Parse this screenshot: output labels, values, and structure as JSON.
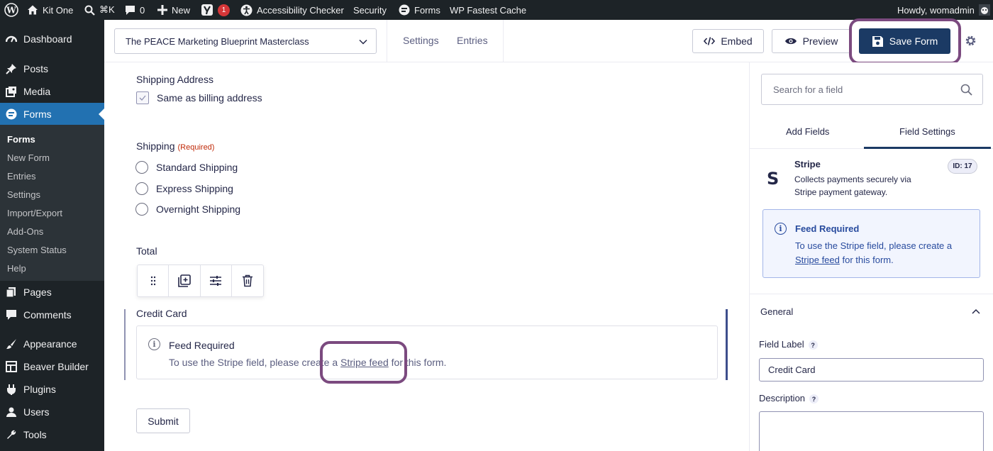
{
  "admin_bar": {
    "site_name": "Kit One",
    "shortcut": "⌘K",
    "comments_count": "0",
    "new_label": "New",
    "yoast_badge": "1",
    "accessibility": "Accessibility Checker",
    "security": "Security",
    "forms": "Forms",
    "cache": "WP Fastest Cache",
    "greeting": "Howdy, womadmin"
  },
  "sidebar": {
    "dashboard": "Dashboard",
    "posts": "Posts",
    "media": "Media",
    "forms": "Forms",
    "submenu": [
      "Forms",
      "New Form",
      "Entries",
      "Settings",
      "Import/Export",
      "Add-Ons",
      "System Status",
      "Help"
    ],
    "pages": "Pages",
    "comments": "Comments",
    "appearance": "Appearance",
    "beaver_builder": "Beaver Builder",
    "plugins": "Plugins",
    "users": "Users",
    "tools": "Tools"
  },
  "header": {
    "form_title": "The PEACE Marketing Blueprint Masterclass",
    "tab_settings": "Settings",
    "tab_entries": "Entries",
    "embed": "Embed",
    "preview": "Preview",
    "save": "Save Form"
  },
  "canvas": {
    "shipping_address_label": "Shipping Address",
    "same_as_billing": "Same as billing address",
    "shipping_label": "Shipping",
    "required": "(Required)",
    "shipping_options": [
      "Standard Shipping",
      "Express Shipping",
      "Overnight Shipping"
    ],
    "total_label": "Total",
    "credit_card_label": "Credit Card",
    "notice_title": "Feed Required",
    "notice_prefix": "To use the Stripe field, please create a ",
    "notice_link": "Stripe feed",
    "notice_suffix": " for this form.",
    "submit": "Submit"
  },
  "panel": {
    "search_placeholder": "Search for a field",
    "tab_add": "Add Fields",
    "tab_settings": "Field Settings",
    "field_name": "Stripe",
    "field_desc_1": "Collects payments securely via",
    "field_desc_2": "Stripe payment gateway.",
    "field_id": "ID: 17",
    "notice_title": "Feed Required",
    "notice_line_1": "To use the Stripe field, please create a",
    "notice_link": "Stripe feed",
    "notice_suffix": " for this form.",
    "general": "General",
    "field_label_title": "Field Label",
    "field_label_value": "Credit Card",
    "description_title": "Description"
  },
  "colors": {
    "admin_bg": "#1d2327",
    "active_menu": "#2271b1",
    "primary_button": "#1b3a64",
    "highlight": "#7b4a7f",
    "required": "#c02b0a"
  }
}
